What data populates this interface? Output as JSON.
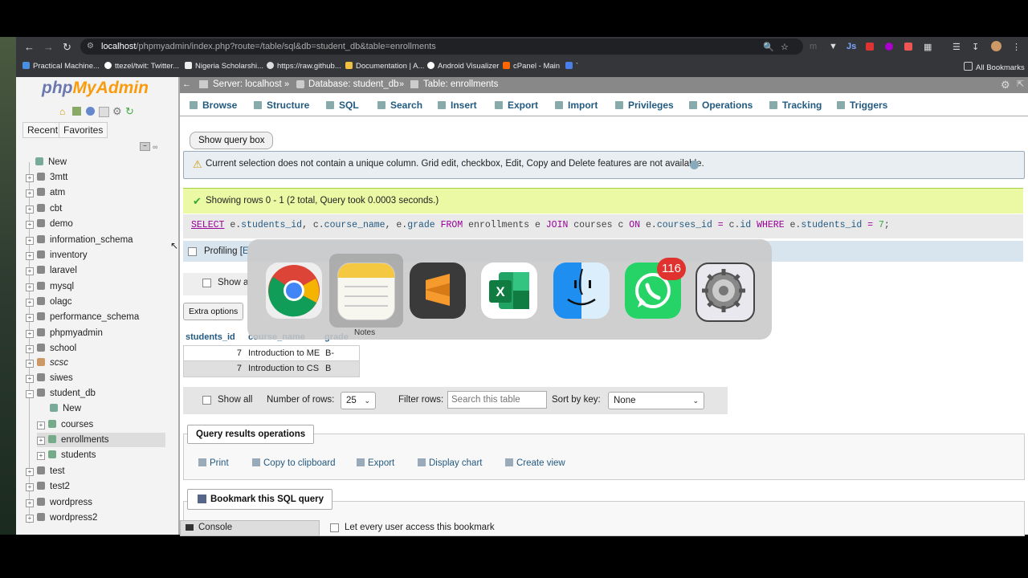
{
  "browser": {
    "url_host": "localhost",
    "url_rest": "/phpmyadmin/index.php?route=/table/sql&db=student_db&table=enrollments",
    "bookmarks": [
      "Practical Machine...",
      "ttezel/twit: Twitter...",
      "Nigeria Scholarshi...",
      "https://raw.github...",
      "Documentation | A...",
      "Android Visualizer",
      "cPanel - Main",
      "`"
    ],
    "all_bookmarks": "All Bookmarks"
  },
  "sidebar": {
    "logo_php": "php",
    "logo_my": "MyAdmin",
    "tabs": [
      "Recent",
      "Favorites"
    ],
    "items": [
      "New",
      "3mtt",
      "atm",
      "cbt",
      "demo",
      "information_schema",
      "inventory",
      "laravel",
      "mysql",
      "olagc",
      "performance_schema",
      "phpmyadmin",
      "school",
      "scsc",
      "siwes",
      "student_db",
      "New",
      "courses",
      "enrollments",
      "students",
      "test",
      "test2",
      "wordpress",
      "wordpress2"
    ]
  },
  "breadcrumb": {
    "server": "Server: localhost",
    "database": "Database: student_db",
    "table": "Table: enrollments"
  },
  "topmenu": [
    "Browse",
    "Structure",
    "SQL",
    "Search",
    "Insert",
    "Export",
    "Import",
    "Privileges",
    "Operations",
    "Tracking",
    "Triggers"
  ],
  "main": {
    "show_query_box": "Show query box",
    "notice": "Current selection does not contain a unique column. Grid edit, checkbox, Edit, Copy and Delete features are not available.",
    "success": "Showing rows 0 - 1 (2 total, Query took 0.0003 seconds.)",
    "sql": {
      "s1": "SELECT",
      "s2": " e.",
      "s3": "students_id",
      "s4": ", c.",
      "s5": "course_name",
      "s6": ", e.",
      "s7": "grade",
      "s8": " FROM",
      "s9": " enrollments e ",
      "s10": "JOIN",
      "s11": " courses c ",
      "s12": "ON",
      "s13": " e.",
      "s14": "courses_id",
      "s15": " = ",
      "s16": "c.",
      "s17": "id",
      "s18": " WHERE",
      "s19": " e.",
      "s20": "students_id",
      "s21": " = ",
      "s22": "7",
      "s23": ";"
    },
    "profiling": "Profiling [",
    "profiling_trail": "E",
    "show_all_short": "Show a",
    "extra_options": "Extra options",
    "table_headers": [
      "students_id",
      "course_name",
      "grade"
    ],
    "rows": [
      {
        "students_id": "7",
        "course_name": "Introduction to ME",
        "grade": "B-"
      },
      {
        "students_id": "7",
        "course_name": "Introduction to CS",
        "grade": "B"
      }
    ],
    "show_all": "Show all",
    "number_of_rows_label": "Number of rows:",
    "number_of_rows_value": "25",
    "filter_rows_label": "Filter rows:",
    "filter_placeholder": "Search this table",
    "sort_by_key_label": "Sort by key:",
    "sort_by_key_value": "None",
    "query_results_operations": "Query results operations",
    "ops": [
      "Print",
      "Copy to clipboard",
      "Export",
      "Display chart",
      "Create view"
    ],
    "bookmark_this": "Bookmark this SQL query",
    "let_every_user": "Let every user access this bookmark",
    "console": "Console"
  },
  "app_switcher": {
    "selected_label": "Notes",
    "whatsapp_badge": "116"
  },
  "colors": {
    "pma_link": "#235a81",
    "success_bg": "#ebf8a4",
    "notice_bg": "#e8eef1"
  }
}
